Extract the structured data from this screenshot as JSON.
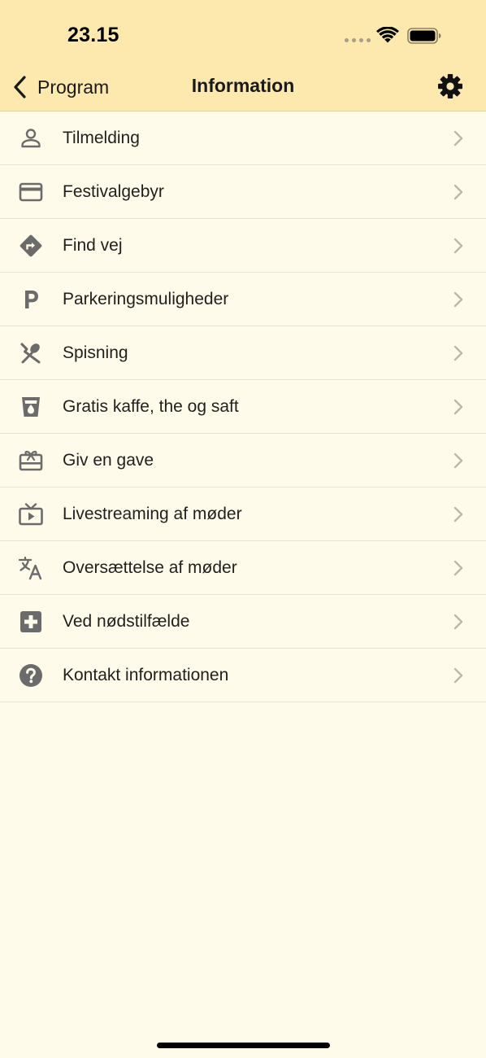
{
  "status": {
    "time": "23.15",
    "icons": [
      "signal-dots-icon",
      "wifi-icon",
      "battery-icon"
    ]
  },
  "nav": {
    "back_label": "Program",
    "title": "Information",
    "settings_icon": "gear-icon"
  },
  "colors": {
    "header_bg": "#FDE8AE",
    "page_bg": "#FFFBEA",
    "icon_gray": "#6B6B6B",
    "chevron_gray": "#BDB8A8"
  },
  "items": [
    {
      "label": "Tilmelding",
      "icon": "person-icon"
    },
    {
      "label": "Festivalgebyr",
      "icon": "credit-card-icon"
    },
    {
      "label": "Find vej",
      "icon": "directions-icon"
    },
    {
      "label": "Parkeringsmuligheder",
      "icon": "parking-icon"
    },
    {
      "label": "Spisning",
      "icon": "utensils-icon"
    },
    {
      "label": "Gratis kaffe, the og saft",
      "icon": "drink-cup-icon"
    },
    {
      "label": "Giv en gave",
      "icon": "gift-card-icon"
    },
    {
      "label": "Livestreaming af møder",
      "icon": "tv-play-icon"
    },
    {
      "label": "Oversættelse af møder",
      "icon": "translate-icon"
    },
    {
      "label": "Ved nødstilfælde",
      "icon": "first-aid-icon"
    },
    {
      "label": "Kontakt informationen",
      "icon": "help-circle-icon"
    }
  ]
}
